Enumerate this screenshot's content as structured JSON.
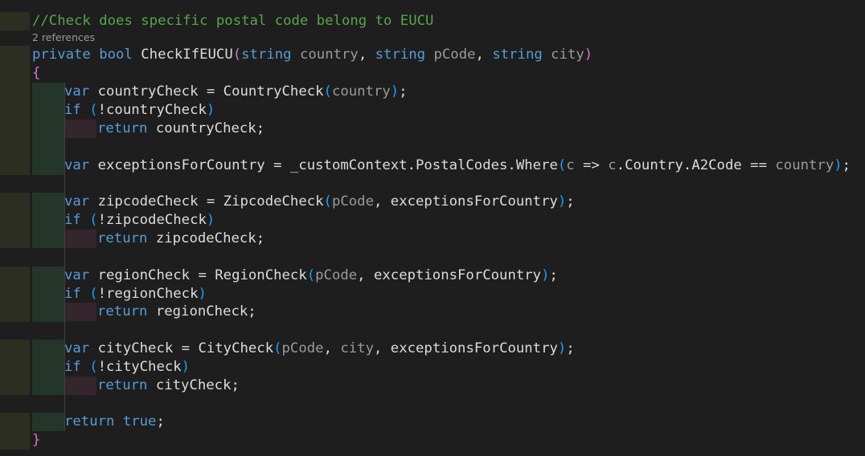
{
  "comment": "//Check does specific postal code belong to EUCU",
  "codelens": "2 references",
  "signature": {
    "kw1": "private",
    "kw2": "bool",
    "name": "CheckIfEUCU",
    "open": "(",
    "t1": "string",
    "p1": "country",
    "t2": "string",
    "p2": "pCode",
    "t3": "string",
    "p3": "city",
    "close": ")"
  },
  "open_brace": "{",
  "close_brace": "}",
  "lines": {
    "l1": {
      "kw": "var",
      "a": " countryCheck = CountryCheck",
      "p1": "(",
      "arg": "country",
      "p2": ")",
      "end": ";"
    },
    "l2": {
      "kw": "if",
      "a": " ",
      "p1": "(",
      "b": "!countryCheck",
      "p2": ")"
    },
    "l3": {
      "kw": "return",
      "a": " countryCheck;"
    },
    "l4": {
      "kw": "var",
      "a": " exceptionsForCountry = _customContext.PostalCodes.Where",
      "p1": "(",
      "c": "c",
      "b": " => ",
      "c2": "c",
      "d": ".Country.A2Code == ",
      "arg": "country",
      "p2": ")",
      "end": ";"
    },
    "l5": {
      "kw": "var",
      "a": " zipcodeCheck = ZipcodeCheck",
      "p1": "(",
      "arg": "pCode",
      "b": ", exceptionsForCountry",
      "p2": ")",
      "end": ";"
    },
    "l6": {
      "kw": "if",
      "a": " ",
      "p1": "(",
      "b": "!zipcodeCheck",
      "p2": ")"
    },
    "l7": {
      "kw": "return",
      "a": " zipcodeCheck;"
    },
    "l8": {
      "kw": "var",
      "a": " regionCheck = RegionCheck",
      "p1": "(",
      "arg": "pCode",
      "b": ", exceptionsForCountry",
      "p2": ")",
      "end": ";"
    },
    "l9": {
      "kw": "if",
      "a": " ",
      "p1": "(",
      "b": "!regionCheck",
      "p2": ")"
    },
    "l10": {
      "kw": "return",
      "a": " regionCheck;"
    },
    "l11": {
      "kw": "var",
      "a": " cityCheck = CityCheck",
      "p1": "(",
      "arg": "pCode",
      "b": ", ",
      "arg2": "city",
      "c": ", exceptionsForCountry",
      "p2": ")",
      "end": ";"
    },
    "l12": {
      "kw": "if",
      "a": " ",
      "p1": "(",
      "b": "!cityCheck",
      "p2": ")"
    },
    "l13": {
      "kw": "return",
      "a": " cityCheck;"
    },
    "l14": {
      "kw": "return",
      "kw2": "true",
      "end": ";"
    }
  },
  "colors": {
    "background": "#1e1e1e",
    "keyword": "#569cd6",
    "comment": "#57a64a",
    "parameter": "#9a9a9a",
    "brace": "#da70d6",
    "paren": "#179fff"
  }
}
